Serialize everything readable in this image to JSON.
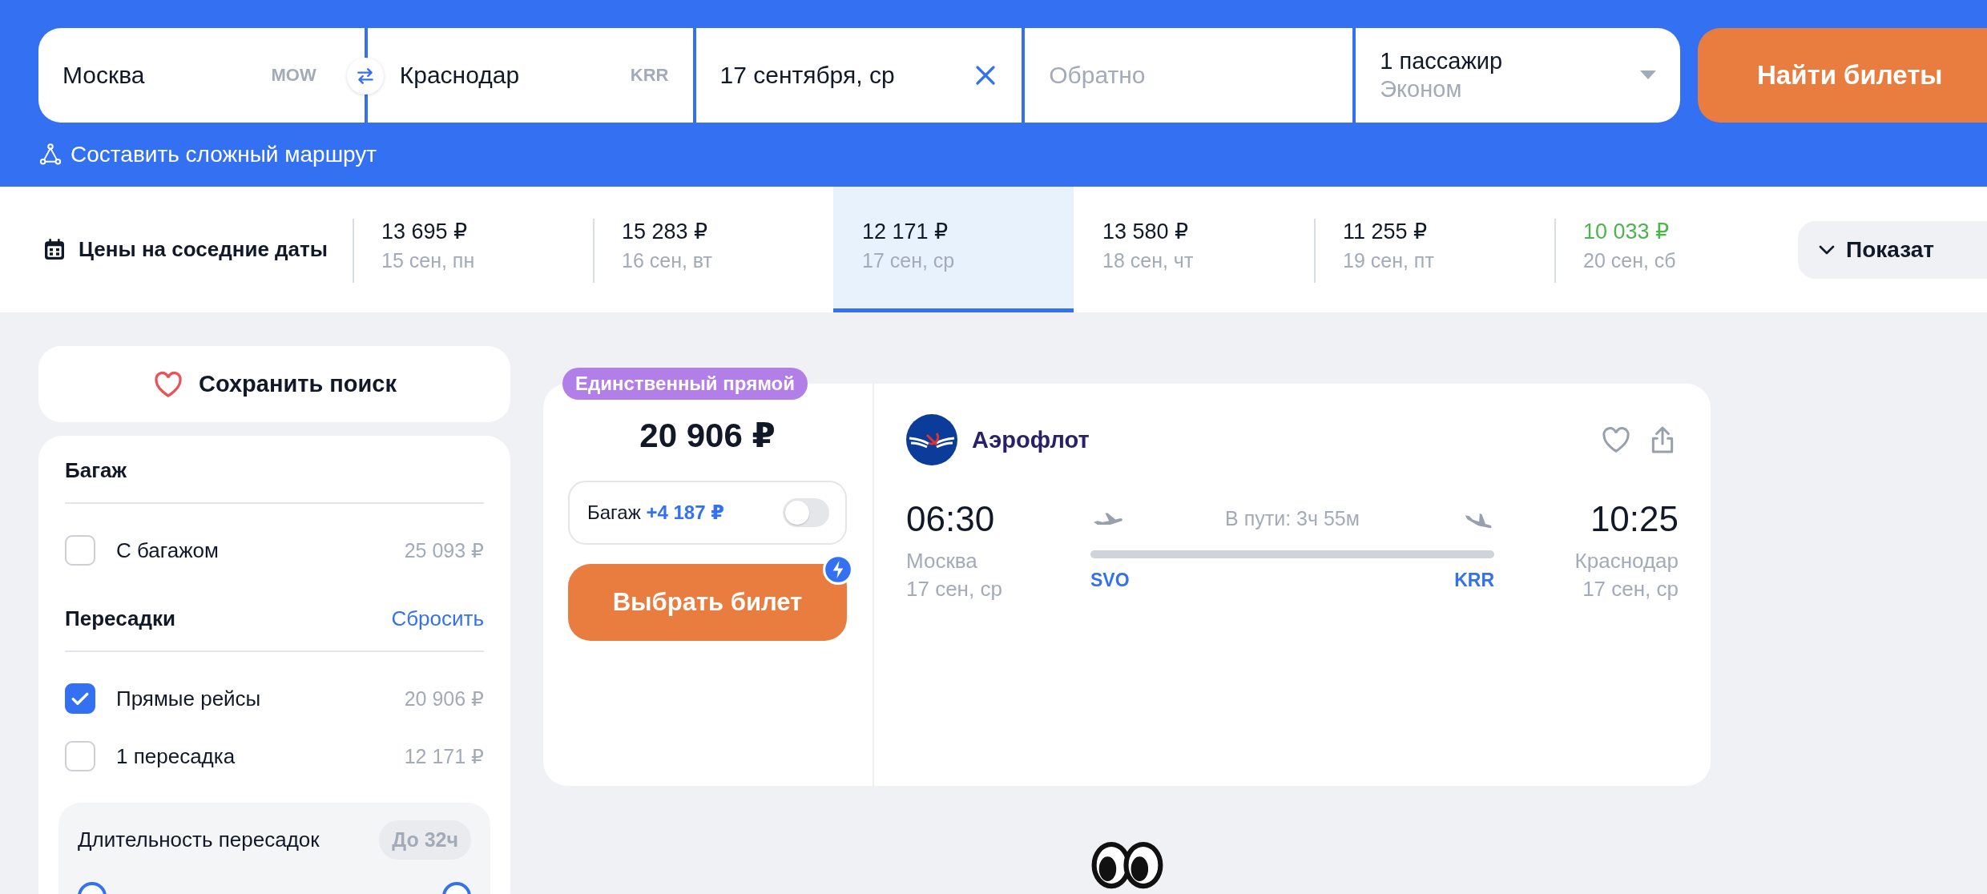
{
  "search": {
    "from": {
      "city": "Москва",
      "code": "MOW"
    },
    "to": {
      "city": "Краснодар",
      "code": "KRR"
    },
    "date": "17 сентября, ср",
    "return_placeholder": "Обратно",
    "passengers": "1 пассажир",
    "cabin": "Эконом",
    "submit": "Найти билеты"
  },
  "complex_route": "Составить сложный маршрут",
  "nearby_dates": {
    "title": "Цены на соседние даты",
    "items": [
      {
        "price": "13 695 ₽",
        "date": "15 сен, пн",
        "selected": false,
        "cheapest": false
      },
      {
        "price": "15 283 ₽",
        "date": "16 сен, вт",
        "selected": false,
        "cheapest": false
      },
      {
        "price": "12 171 ₽",
        "date": "17 сен, ср",
        "selected": true,
        "cheapest": false
      },
      {
        "price": "13 580 ₽",
        "date": "18 сен, чт",
        "selected": false,
        "cheapest": false
      },
      {
        "price": "11 255 ₽",
        "date": "19 сен, пт",
        "selected": false,
        "cheapest": false
      },
      {
        "price": "10 033 ₽",
        "date": "20 сен, сб",
        "selected": false,
        "cheapest": true
      }
    ],
    "show_button": "Показат"
  },
  "save_search": "Сохранить поиск",
  "filters": {
    "sections": [
      {
        "title": "Багаж",
        "items": [
          {
            "label": "С багажом",
            "price": "25 093 ₽",
            "checked": false
          }
        ]
      },
      {
        "title": "Пересадки",
        "reset": "Сбросить",
        "items": [
          {
            "label": "Прямые рейсы",
            "price": "20 906 ₽",
            "checked": true
          },
          {
            "label": "1 пересадка",
            "price": "12 171 ₽",
            "checked": false
          }
        ]
      }
    ],
    "duration": {
      "label": "Длительность пересадок",
      "badge": "До 32ч",
      "level": 1
    }
  },
  "ticket": {
    "badge": "Единственный прямой",
    "price": "20 906 ₽",
    "baggage": {
      "label": "Багаж",
      "extra": "+4 187 ₽",
      "on": false
    },
    "select_button": "Выбрать билет",
    "airline": "Аэрофлот",
    "departure": {
      "time": "06:30",
      "city": "Москва",
      "date": "17 сен, ср",
      "airport": "SVO"
    },
    "duration": "В пути: 3ч 55м",
    "arrival": {
      "time": "10:25",
      "city": "Краснодар",
      "date": "17 сен, ср",
      "airport": "KRR"
    }
  }
}
